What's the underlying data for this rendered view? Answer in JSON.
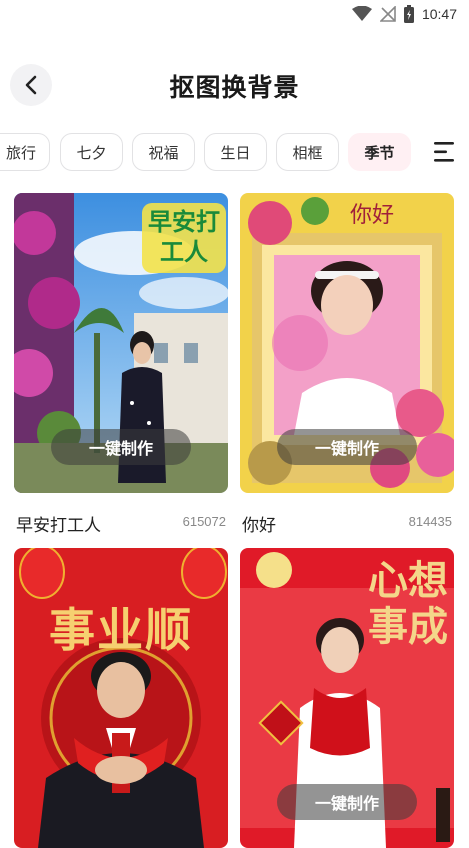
{
  "status_bar": {
    "time": "10:47"
  },
  "header": {
    "title": "抠图换背景"
  },
  "tabs": [
    {
      "label": "旅行"
    },
    {
      "label": "七夕"
    },
    {
      "label": "祝福"
    },
    {
      "label": "生日"
    },
    {
      "label": "相框"
    },
    {
      "label": "季节"
    }
  ],
  "active_tab": "季节",
  "accent_color": "#fff0f3",
  "cards": [
    {
      "title": "早安打工人",
      "count": "615072",
      "button": "一键制作",
      "image_text": "早安打工人"
    },
    {
      "title": "你好",
      "count": "814435",
      "button": "一键制作",
      "image_text": "你好"
    },
    {
      "image_text": "事业顺"
    },
    {
      "image_text": "心想事成",
      "button": "一键制作"
    }
  ]
}
